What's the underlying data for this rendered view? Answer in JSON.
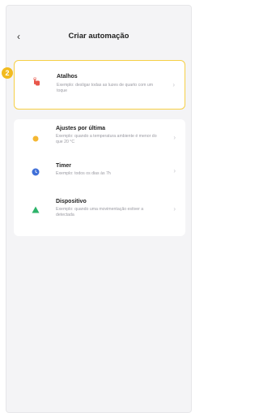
{
  "header": {
    "back_glyph": "‹",
    "title": "Criar automação"
  },
  "callout": {
    "number": "2"
  },
  "top_item": {
    "title": "Atalhos",
    "desc": "Exemplo: desligar todas as luzes de quarto com um toque",
    "icon": "hand-tap-icon",
    "color": "#e8564a"
  },
  "items": [
    {
      "title": "Ajustes por última",
      "desc": "Exemplo: quando a temperatura ambiente é menor do que 20 °C",
      "icon": "weather-icon",
      "color": "#f4b733"
    },
    {
      "title": "Timer",
      "desc": "Exemplo: todos os dias às 7h",
      "icon": "timer-icon",
      "color": "#3f6fd8"
    },
    {
      "title": "Dispositivo",
      "desc": "Exemplo: quando uma movimentação estiver a detectada",
      "icon": "device-icon",
      "color": "#2db36a"
    }
  ],
  "chevron_glyph": "›"
}
